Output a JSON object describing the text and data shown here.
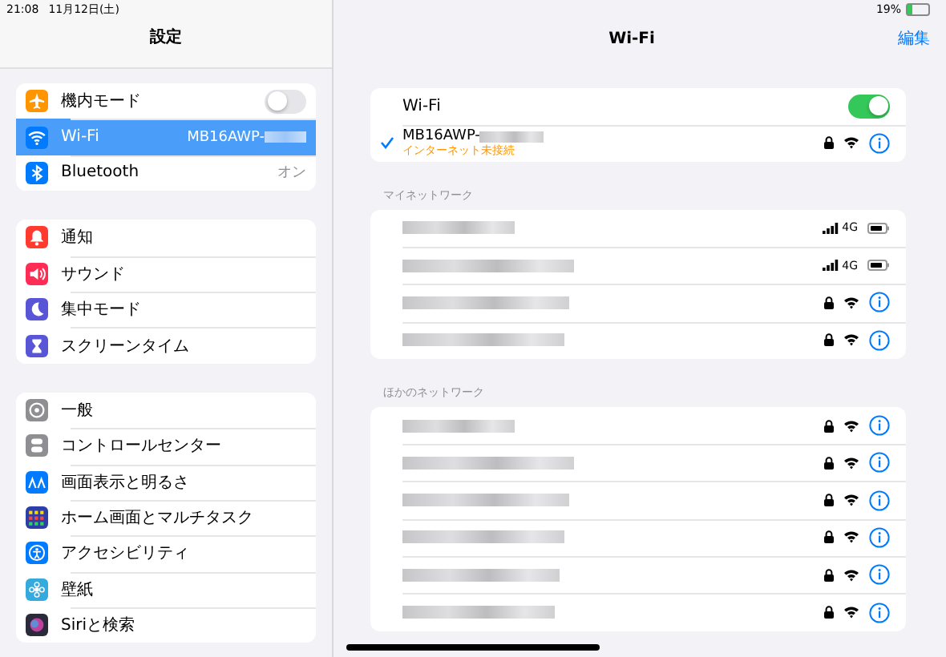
{
  "status_bar": {
    "time": "21:08",
    "date": "11月12日(土)",
    "battery": "19%"
  },
  "sidebar": {
    "title": "設定",
    "groups": [
      {
        "items": [
          {
            "label": "機内モード",
            "color": "#ff9500",
            "kind": "toggle",
            "on": false,
            "selected": false
          },
          {
            "label": "Wi-Fi",
            "color": "#007aff",
            "kind": "value",
            "value": "MB16AWP-",
            "selected": true
          },
          {
            "label": "Bluetooth",
            "color": "#007aff",
            "kind": "value",
            "value": "オン",
            "selected": false
          }
        ]
      },
      {
        "items": [
          {
            "label": "通知",
            "color": "#ff3b30",
            "kind": "link",
            "selected": false
          },
          {
            "label": "サウンド",
            "color": "#ff2d55",
            "kind": "link",
            "selected": false
          },
          {
            "label": "集中モード",
            "color": "#5856d6",
            "kind": "link",
            "selected": false
          },
          {
            "label": "スクリーンタイム",
            "color": "#5856d6",
            "kind": "link",
            "selected": false
          }
        ]
      },
      {
        "items": [
          {
            "label": "一般",
            "color": "#8e8e93",
            "kind": "link",
            "selected": false
          },
          {
            "label": "コントロールセンター",
            "color": "#8e8e93",
            "kind": "link",
            "selected": false
          },
          {
            "label": "画面表示と明るさ",
            "color": "#007aff",
            "kind": "link",
            "selected": false
          },
          {
            "label": "ホーム画面とマルチタスク",
            "color": "#2c3ea8",
            "kind": "link",
            "selected": false
          },
          {
            "label": "アクセシビリティ",
            "color": "#007aff",
            "kind": "link",
            "selected": false
          },
          {
            "label": "壁紙",
            "color": "#35aadc",
            "kind": "link",
            "selected": false
          },
          {
            "label": "Siriと検索",
            "color": "#2a2a3a",
            "kind": "link",
            "selected": false
          }
        ]
      }
    ]
  },
  "wifi": {
    "title": "Wi-Fi",
    "edit": "編集",
    "label": "Wi-Fi",
    "on": true,
    "current": {
      "name": "MB16AWP-",
      "status": "インターネット未接続",
      "checked": true
    },
    "my_networks": {
      "header": "マイネットワーク",
      "items": [
        {
          "kind": "hotspot",
          "network": "4G"
        },
        {
          "kind": "hotspot",
          "network": "4G"
        },
        {
          "kind": "wifi"
        },
        {
          "kind": "wifi"
        }
      ]
    },
    "other_networks": {
      "header": "ほかのネットワーク",
      "items": [
        {
          "kind": "wifi"
        },
        {
          "kind": "wifi"
        },
        {
          "kind": "wifi"
        },
        {
          "kind": "wifi"
        },
        {
          "kind": "wifi"
        },
        {
          "kind": "wifi"
        }
      ]
    }
  }
}
